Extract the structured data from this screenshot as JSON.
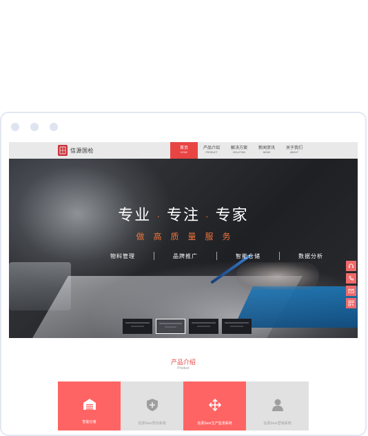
{
  "site": {
    "logo_text": "信源国检",
    "nav": [
      {
        "cn": "首页",
        "en": "HOME",
        "active": true
      },
      {
        "cn": "产品介绍",
        "en": "PRODUCT",
        "active": false
      },
      {
        "cn": "解决方案",
        "en": "SOLUTION",
        "active": false
      },
      {
        "cn": "新闻资讯",
        "en": "NEWS",
        "active": false
      },
      {
        "cn": "关于我们",
        "en": "ABOUT",
        "active": false
      }
    ]
  },
  "hero": {
    "slogan": [
      "专业",
      "专注",
      "专家"
    ],
    "separator": "·",
    "subtitle": "做高质量服务",
    "features": [
      "物料管理",
      "品牌推广",
      "智能仓储",
      "数据分析"
    ]
  },
  "side_icons": [
    "headset-icon",
    "phone-icon",
    "mail-icon",
    "qrcode-icon"
  ],
  "products": {
    "title": "产品介绍",
    "subtitle": "Product",
    "tiles": [
      {
        "label": "智能仓储",
        "icon": "warehouse-icon",
        "style": "red"
      },
      {
        "label": "信源Seer防伪系统",
        "icon": "shield-plus-icon",
        "style": "grey"
      },
      {
        "label": "信源Seer生产监测系统",
        "icon": "move-arrows-icon",
        "style": "red"
      },
      {
        "label": "信源Seer营销系统",
        "icon": "user-icon",
        "style": "grey"
      }
    ]
  },
  "colors": {
    "accent": "#e84444",
    "tile_red": "#ff6464",
    "tile_grey": "#e1e1e1",
    "subtitle_orange": "#f0743a"
  }
}
